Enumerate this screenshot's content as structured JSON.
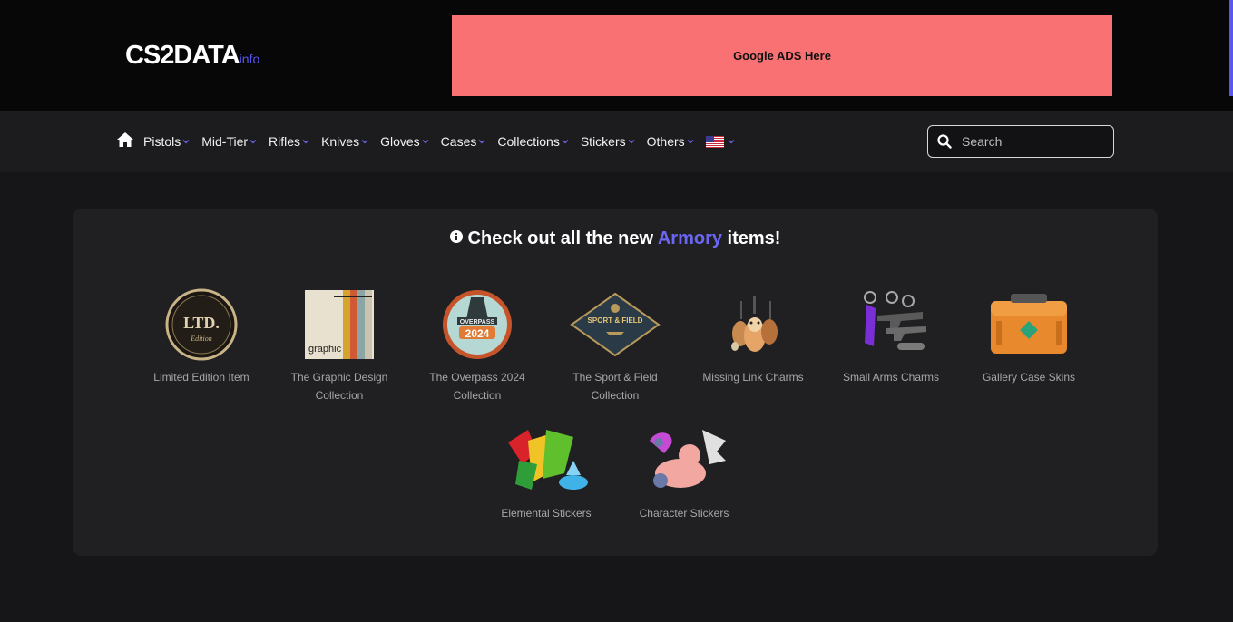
{
  "header": {
    "logo_main": "CS2DATA",
    "logo_suffix": "info",
    "ad_text": "Google ADS Here"
  },
  "nav": {
    "home_icon": "home-icon",
    "items": [
      {
        "label": "Pistols"
      },
      {
        "label": "Mid-Tier"
      },
      {
        "label": "Rifles"
      },
      {
        "label": "Knives"
      },
      {
        "label": "Gloves"
      },
      {
        "label": "Cases"
      },
      {
        "label": "Collections"
      },
      {
        "label": "Stickers"
      },
      {
        "label": "Others"
      }
    ],
    "language_flag": "us-flag-icon",
    "search_placeholder": "Search"
  },
  "banner": {
    "prefix": "Check out all the new ",
    "highlight": "Armory",
    "suffix": " items!"
  },
  "items": [
    {
      "line1": "Limited Edition Item",
      "line2": ""
    },
    {
      "line1": "The Graphic Design",
      "line2": "Collection"
    },
    {
      "line1": "The Overpass 2024",
      "line2": "Collection"
    },
    {
      "line1": "The Sport & Field",
      "line2": "Collection"
    },
    {
      "line1": "Missing Link Charms",
      "line2": ""
    },
    {
      "line1": "Small Arms Charms",
      "line2": ""
    },
    {
      "line1": "Gallery Case Skins",
      "line2": ""
    },
    {
      "line1": "Elemental Stickers",
      "line2": ""
    },
    {
      "line1": "Character Stickers",
      "line2": ""
    }
  ],
  "badge_text": {
    "ltd": "LTD.",
    "ltd_sub": "Edition",
    "graphic": "graphic",
    "overpass_top": "OVERPASS",
    "overpass_year": "2024",
    "sport": "SPORT & FIELD"
  },
  "colors": {
    "accent": "#5b55f2",
    "ad_background": "#f97173",
    "page_background": "#161619",
    "panel_background": "#202022"
  }
}
